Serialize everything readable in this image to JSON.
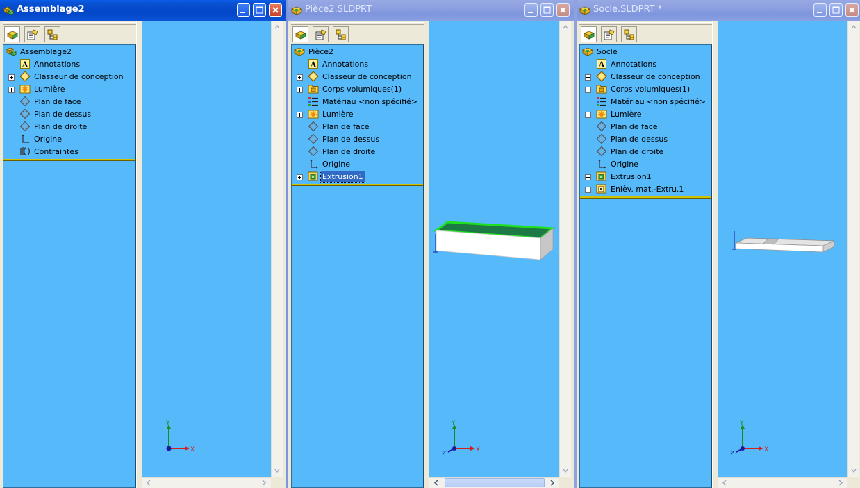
{
  "windows": [
    {
      "title": "Assemblage2",
      "active": true,
      "tree": [
        {
          "label": "Assemblage2",
          "icon": "assembly-icon",
          "expand": false,
          "root": true
        },
        {
          "label": "Annotations",
          "icon": "annotations-icon",
          "expand": false
        },
        {
          "label": "Classeur de conception",
          "icon": "design-binder-icon",
          "expand": true
        },
        {
          "label": "Lumière",
          "icon": "lighting-icon",
          "expand": true
        },
        {
          "label": "Plan de face",
          "icon": "plane-icon",
          "expand": false
        },
        {
          "label": "Plan de dessus",
          "icon": "plane-icon",
          "expand": false
        },
        {
          "label": "Plan de droite",
          "icon": "plane-icon",
          "expand": false
        },
        {
          "label": "Origine",
          "icon": "origin-icon",
          "expand": false
        },
        {
          "label": "Contraintes",
          "icon": "mates-icon",
          "expand": false
        }
      ],
      "axis_labels": {
        "y": "Y",
        "x": "X"
      }
    },
    {
      "title": "Pièce2.SLDPRT",
      "active": false,
      "tree": [
        {
          "label": "Pièce2",
          "icon": "part-icon",
          "expand": false,
          "root": true
        },
        {
          "label": "Annotations",
          "icon": "annotations-icon",
          "expand": false
        },
        {
          "label": "Classeur de conception",
          "icon": "design-binder-icon",
          "expand": true
        },
        {
          "label": "Corps volumiques(1)",
          "icon": "solid-bodies-icon",
          "expand": true
        },
        {
          "label": "Matériau <non spécifié>",
          "icon": "material-icon",
          "expand": false
        },
        {
          "label": "Lumière",
          "icon": "lighting-icon",
          "expand": true
        },
        {
          "label": "Plan de face",
          "icon": "plane-icon",
          "expand": false
        },
        {
          "label": "Plan de dessus",
          "icon": "plane-icon",
          "expand": false
        },
        {
          "label": "Plan de droite",
          "icon": "plane-icon",
          "expand": false
        },
        {
          "label": "Origine",
          "icon": "origin-icon",
          "expand": false
        },
        {
          "label": "Extrusion1",
          "icon": "extrude-icon",
          "expand": true,
          "selected": true
        }
      ],
      "axis_labels": {
        "y": "Y",
        "x": "X",
        "z": "Z"
      }
    },
    {
      "title": "Socle.SLDPRT *",
      "active": false,
      "tree": [
        {
          "label": "Socle",
          "icon": "part-icon",
          "expand": false,
          "root": true
        },
        {
          "label": "Annotations",
          "icon": "annotations-icon",
          "expand": false
        },
        {
          "label": "Classeur de conception",
          "icon": "design-binder-icon",
          "expand": true
        },
        {
          "label": "Corps volumiques(1)",
          "icon": "solid-bodies-icon",
          "expand": true
        },
        {
          "label": "Matériau <non spécifié>",
          "icon": "material-icon",
          "expand": false
        },
        {
          "label": "Lumière",
          "icon": "lighting-icon",
          "expand": true
        },
        {
          "label": "Plan de face",
          "icon": "plane-icon",
          "expand": false
        },
        {
          "label": "Plan de dessus",
          "icon": "plane-icon",
          "expand": false
        },
        {
          "label": "Plan de droite",
          "icon": "plane-icon",
          "expand": false
        },
        {
          "label": "Origine",
          "icon": "origin-icon",
          "expand": false
        },
        {
          "label": "Extrusion1",
          "icon": "extrude-icon",
          "expand": true
        },
        {
          "label": "Enlèv. mat.-Extru.1",
          "icon": "cut-extrude-icon",
          "expand": true
        }
      ],
      "axis_labels": {
        "y": "Y",
        "x": "X",
        "z": "Z"
      }
    }
  ],
  "tabs": [
    "featuremanager-tab",
    "propertymanager-tab",
    "configurationmanager-tab"
  ],
  "colors": {
    "viewport": "#55b9fa",
    "rollback_bar": "#cfc000",
    "selected_face": "#1d7a44",
    "face_edge": "#1fe01f"
  }
}
